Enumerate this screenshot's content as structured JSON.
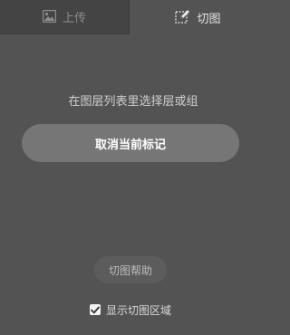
{
  "tabs": {
    "upload": {
      "label": "上传",
      "icon": "image-icon",
      "active": false
    },
    "slice": {
      "label": "切图",
      "icon": "slice-edit-icon",
      "active": true
    }
  },
  "main": {
    "instruction": "在图层列表里选择层或组",
    "cancel_mark_label": "取消当前标记",
    "help_label": "切图帮助",
    "show_slice_area": {
      "label": "显示切图区域",
      "checked": true
    }
  },
  "colors": {
    "panel_bg": "#535353",
    "inactive_tab_bg": "#444444",
    "primary_button_bg": "#767676"
  }
}
